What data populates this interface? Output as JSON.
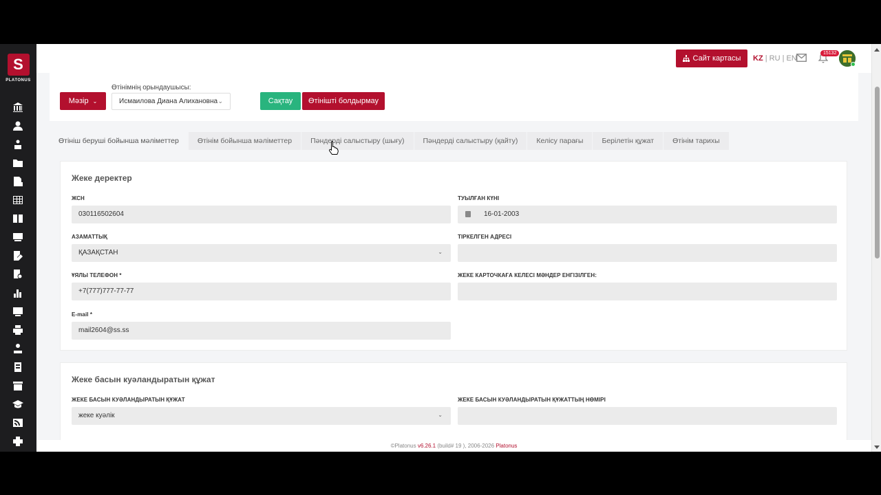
{
  "brand": {
    "name": "PLATONUS",
    "logo_letter": "S"
  },
  "topbar": {
    "sitemap_label": "Сайт картасы",
    "lang": {
      "kz": "KZ",
      "ru": "RU",
      "en": "EN",
      "sep": "|"
    },
    "notif_count": "15132"
  },
  "header": {
    "status_label": "Мәзір",
    "executor_label": "Өтінімнің орындаушысы:",
    "executor_value": "Исмаилова Диана Алихановна",
    "save_label": "Сақтау",
    "cancel_label": "Өтінішті болдырмау"
  },
  "tabs": [
    {
      "label": "Өтініш беруші бойынша мәліметтер",
      "active": true
    },
    {
      "label": "Өтінім бойынша мәліметтер"
    },
    {
      "label": "Пәндерді салыстыру (шығу)"
    },
    {
      "label": "Пәндерді салыстыру (қайту)"
    },
    {
      "label": "Келісу парағы"
    },
    {
      "label": "Берілетін құжат"
    },
    {
      "label": "Өтінім тарихы"
    }
  ],
  "personal": {
    "title": "Жеке деректер",
    "iin_label": "ЖСН",
    "iin_value": "030116502604",
    "birth_label": "Туылған күні",
    "birth_value": "16-01-2003",
    "citizenship_label": "Азаматтық",
    "citizenship_value": "ҚАЗАҚСТАН",
    "address_label": "Тіркелген адресі",
    "address_value": "",
    "phone_label": "Ұялы телефон *",
    "phone_value": "+7(777)777-77-77",
    "card_label": "Жеке карточкаға келесі мәндер енгізілген:",
    "card_value": "",
    "email_label": "E-mail *",
    "email_value": "mail2604@ss.ss"
  },
  "id_doc": {
    "title": "Жеке басын куәландыратын құжат",
    "doc_label": "Жеке басын куәландыратын құжат",
    "doc_value": "жеке куәлік",
    "number_label": "Жеке басын куәландыратын құжаттың нөмірі",
    "number_value": ""
  },
  "footer": {
    "copyright": "©Platonus",
    "version": "v6.26.1",
    "build": "(build# 19 ), 2006-2026",
    "brand": "Platonus"
  }
}
